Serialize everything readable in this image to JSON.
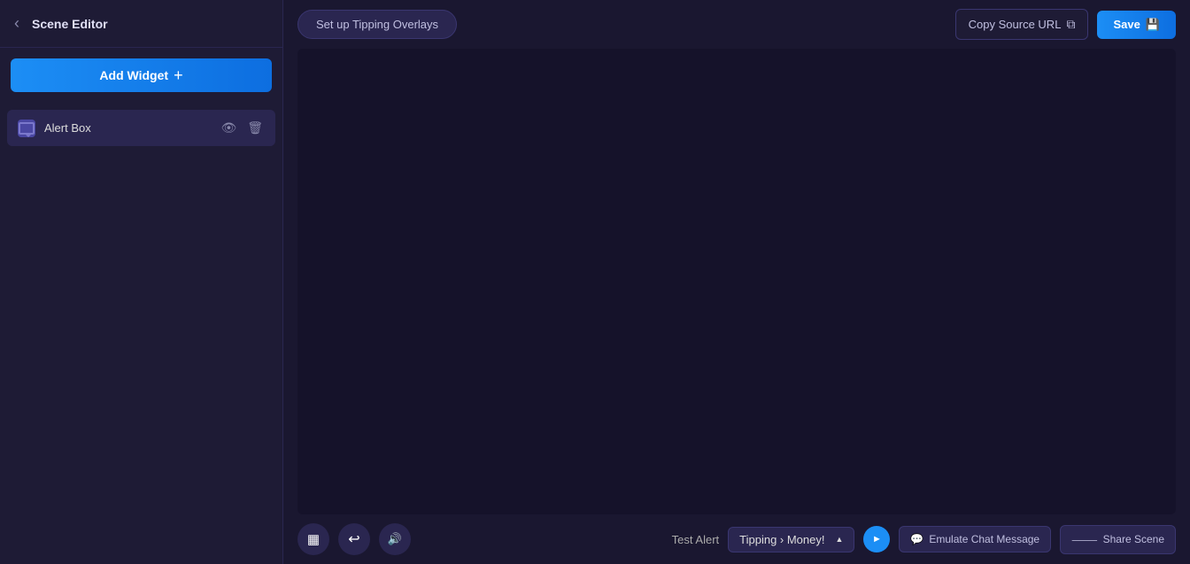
{
  "sidebar": {
    "title": "Scene Editor",
    "back_label": "‹",
    "add_widget_label": "Add Widget",
    "widgets": [
      {
        "id": "alert-box",
        "label": "Alert Box",
        "icon": "alert-box-icon"
      }
    ]
  },
  "toolbar": {
    "setup_label": "Set up Tipping Overlays",
    "copy_url_label": "Copy Source URL",
    "save_label": "Save"
  },
  "bottom_bar": {
    "tools": [
      {
        "id": "resize",
        "icon": "resize-icon",
        "label": "⛶"
      },
      {
        "id": "undo",
        "icon": "undo-icon",
        "label": "↩"
      },
      {
        "id": "volume",
        "icon": "volume-icon",
        "label": "♪"
      }
    ],
    "test_alert_label": "Test Alert",
    "test_alert_value": "Tipping › Money!",
    "emulate_label": "Emulate Chat Message",
    "share_label": "Share Scene"
  }
}
